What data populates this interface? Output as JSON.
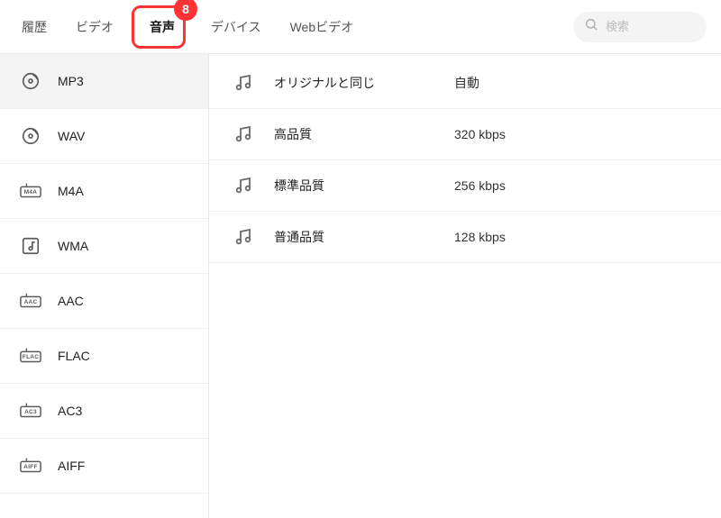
{
  "header": {
    "tabs": [
      {
        "label": "履歴"
      },
      {
        "label": "ビデオ"
      },
      {
        "label": "音声",
        "active": true,
        "badge": "8"
      },
      {
        "label": "デバイス"
      },
      {
        "label": "Webビデオ"
      }
    ],
    "search_placeholder": "検索"
  },
  "sidebar": {
    "items": [
      {
        "label": "MP3",
        "icon": "disc",
        "active": true
      },
      {
        "label": "WAV",
        "icon": "disc"
      },
      {
        "label": "M4A",
        "icon": "badge",
        "badge_text": "M4A"
      },
      {
        "label": "WMA",
        "icon": "note-box"
      },
      {
        "label": "AAC",
        "icon": "badge",
        "badge_text": "AAC"
      },
      {
        "label": "FLAC",
        "icon": "badge",
        "badge_text": "FLAC"
      },
      {
        "label": "AC3",
        "icon": "badge",
        "badge_text": "AC3"
      },
      {
        "label": "AIFF",
        "icon": "badge",
        "badge_text": "AIFF"
      }
    ]
  },
  "content": {
    "qualities": [
      {
        "label": "オリジナルと同じ",
        "bitrate": "自動"
      },
      {
        "label": "高品質",
        "bitrate": "320 kbps"
      },
      {
        "label": "標準品質",
        "bitrate": "256 kbps"
      },
      {
        "label": "普通品質",
        "bitrate": "128 kbps"
      }
    ]
  }
}
